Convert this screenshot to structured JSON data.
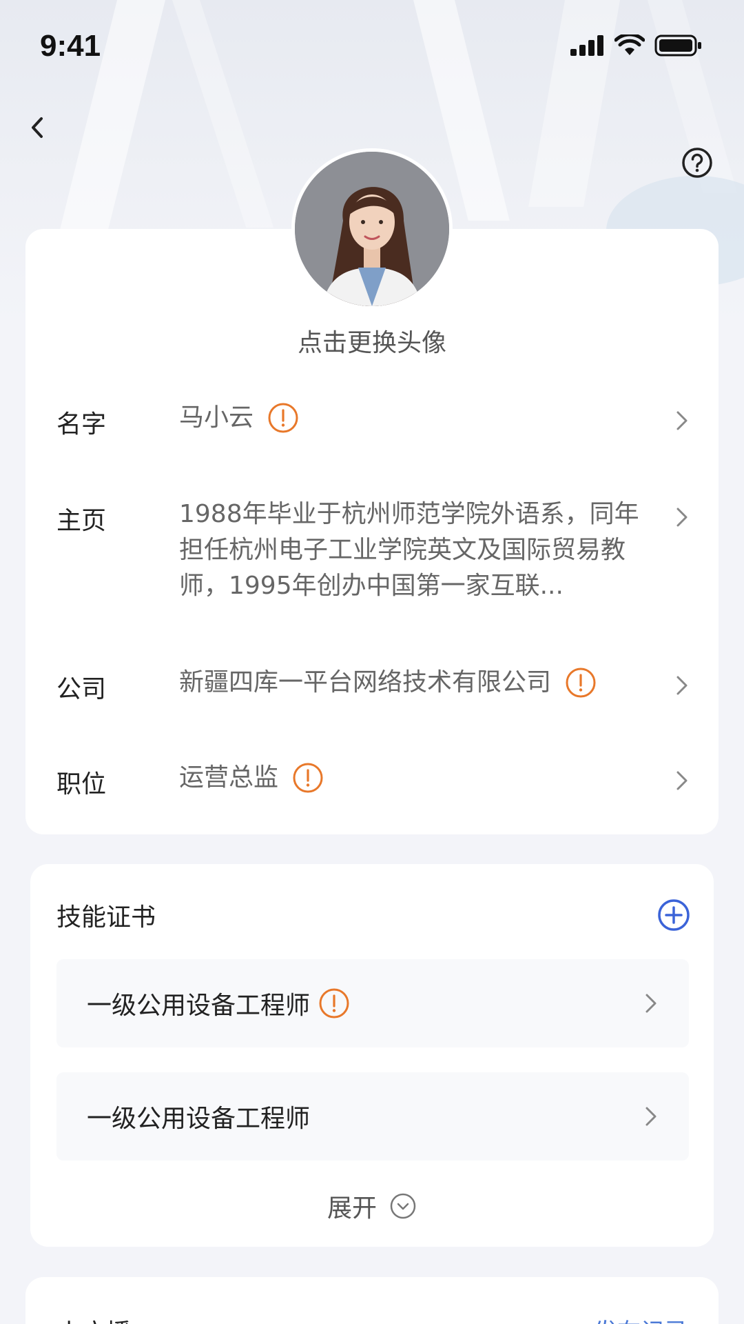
{
  "status_bar": {
    "time": "9:41"
  },
  "header": {
    "avatar_hint": "点击更换头像"
  },
  "profile": {
    "rows": [
      {
        "label": "名字",
        "value": "马小云",
        "warning": true
      },
      {
        "label": "主页",
        "value": "1988年毕业于杭州师范学院外语系，同年担任杭州电子工业学院英文及国际贸易教师，1995年创办中国第一家互联...",
        "warning": false
      },
      {
        "label": "公司",
        "value": "新疆四库一平台网络技术有限公司",
        "warning": true
      },
      {
        "label": "职位",
        "value": "运营总监",
        "warning": true
      }
    ]
  },
  "certificates": {
    "title": "技能证书",
    "items": [
      {
        "name": "一级公用设备工程师",
        "warning": true
      },
      {
        "name": "一级公用设备工程师",
        "warning": false
      }
    ],
    "expand_label": "展开"
  },
  "next_section": {
    "title": "小广播",
    "link": "发布记录"
  },
  "colors": {
    "warning": "#e8782a",
    "accent": "#3b63d8",
    "link": "#4a78d6"
  }
}
